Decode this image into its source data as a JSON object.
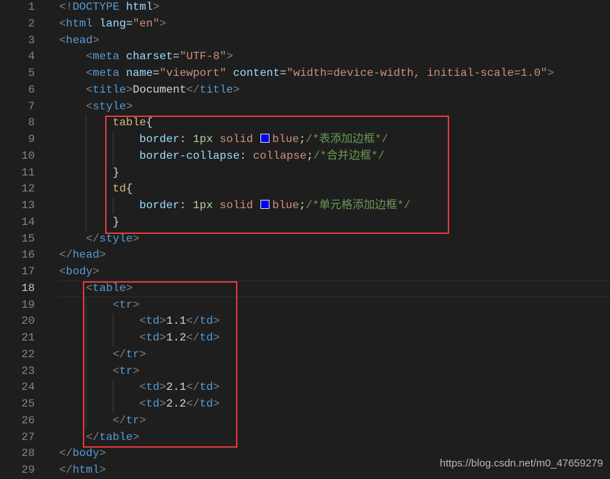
{
  "editor": {
    "active_line": 18,
    "lines": [
      {
        "n": "1",
        "indent": 0,
        "tokens": [
          [
            "p",
            "<!"
          ],
          [
            "t",
            "DOCTYPE"
          ],
          [
            "x",
            " "
          ],
          [
            "a",
            "html"
          ],
          [
            "p",
            ">"
          ]
        ]
      },
      {
        "n": "2",
        "indent": 0,
        "tokens": [
          [
            "p",
            "<"
          ],
          [
            "t",
            "html"
          ],
          [
            "x",
            " "
          ],
          [
            "a",
            "lang"
          ],
          [
            "x",
            "="
          ],
          [
            "s",
            "\"en\""
          ],
          [
            "p",
            ">"
          ]
        ]
      },
      {
        "n": "3",
        "indent": 0,
        "tokens": [
          [
            "p",
            "<"
          ],
          [
            "t",
            "head"
          ],
          [
            "p",
            ">"
          ]
        ]
      },
      {
        "n": "4",
        "indent": 1,
        "tokens": [
          [
            "p",
            "<"
          ],
          [
            "t",
            "meta"
          ],
          [
            "x",
            " "
          ],
          [
            "a",
            "charset"
          ],
          [
            "x",
            "="
          ],
          [
            "s",
            "\"UTF-8\""
          ],
          [
            "p",
            ">"
          ]
        ]
      },
      {
        "n": "5",
        "indent": 1,
        "tokens": [
          [
            "p",
            "<"
          ],
          [
            "t",
            "meta"
          ],
          [
            "x",
            " "
          ],
          [
            "a",
            "name"
          ],
          [
            "x",
            "="
          ],
          [
            "s",
            "\"viewport\""
          ],
          [
            "x",
            " "
          ],
          [
            "a",
            "content"
          ],
          [
            "x",
            "="
          ],
          [
            "s",
            "\"width=device-width, initial-scale=1.0\""
          ],
          [
            "p",
            ">"
          ]
        ]
      },
      {
        "n": "6",
        "indent": 1,
        "tokens": [
          [
            "p",
            "<"
          ],
          [
            "t",
            "title"
          ],
          [
            "p",
            ">"
          ],
          [
            "x",
            "Document"
          ],
          [
            "p",
            "</"
          ],
          [
            "t",
            "title"
          ],
          [
            "p",
            ">"
          ]
        ]
      },
      {
        "n": "7",
        "indent": 1,
        "tokens": [
          [
            "p",
            "<"
          ],
          [
            "t",
            "style"
          ],
          [
            "p",
            ">"
          ]
        ]
      },
      {
        "n": "8",
        "indent": 2,
        "tokens": [
          [
            "sel",
            "table"
          ],
          [
            "x",
            "{"
          ]
        ]
      },
      {
        "n": "9",
        "indent": 3,
        "tokens": [
          [
            "pr",
            "border"
          ],
          [
            "x",
            ": "
          ],
          [
            "n",
            "1px"
          ],
          [
            "x",
            " "
          ],
          [
            "v",
            "solid "
          ],
          [
            "sw",
            ""
          ],
          [
            "v",
            "blue"
          ],
          [
            "x",
            ";"
          ],
          [
            "c",
            "/*表添加边框*/"
          ]
        ]
      },
      {
        "n": "10",
        "indent": 3,
        "tokens": [
          [
            "pr",
            "border-collapse"
          ],
          [
            "x",
            ": "
          ],
          [
            "v",
            "collapse"
          ],
          [
            "x",
            ";"
          ],
          [
            "c",
            "/*合并边框*/"
          ]
        ]
      },
      {
        "n": "11",
        "indent": 2,
        "tokens": [
          [
            "x",
            "}"
          ]
        ]
      },
      {
        "n": "12",
        "indent": 2,
        "tokens": [
          [
            "sel",
            "td"
          ],
          [
            "x",
            "{"
          ]
        ]
      },
      {
        "n": "13",
        "indent": 3,
        "tokens": [
          [
            "pr",
            "border"
          ],
          [
            "x",
            ": "
          ],
          [
            "n",
            "1px"
          ],
          [
            "x",
            " "
          ],
          [
            "v",
            "solid "
          ],
          [
            "sw",
            ""
          ],
          [
            "v",
            "blue"
          ],
          [
            "x",
            ";"
          ],
          [
            "c",
            "/*单元格添加边框*/"
          ]
        ]
      },
      {
        "n": "14",
        "indent": 2,
        "tokens": [
          [
            "x",
            "}"
          ]
        ]
      },
      {
        "n": "15",
        "indent": 1,
        "tokens": [
          [
            "p",
            "</"
          ],
          [
            "t",
            "style"
          ],
          [
            "p",
            ">"
          ]
        ]
      },
      {
        "n": "16",
        "indent": 0,
        "tokens": [
          [
            "p",
            "</"
          ],
          [
            "t",
            "head"
          ],
          [
            "p",
            ">"
          ]
        ]
      },
      {
        "n": "17",
        "indent": 0,
        "tokens": [
          [
            "p",
            "<"
          ],
          [
            "t",
            "body"
          ],
          [
            "p",
            ">"
          ]
        ]
      },
      {
        "n": "18",
        "indent": 1,
        "tokens": [
          [
            "p",
            "<"
          ],
          [
            "t",
            "table"
          ],
          [
            "p",
            ">"
          ]
        ]
      },
      {
        "n": "19",
        "indent": 2,
        "tokens": [
          [
            "p",
            "<"
          ],
          [
            "t",
            "tr"
          ],
          [
            "p",
            ">"
          ]
        ]
      },
      {
        "n": "20",
        "indent": 3,
        "tokens": [
          [
            "p",
            "<"
          ],
          [
            "t",
            "td"
          ],
          [
            "p",
            ">"
          ],
          [
            "x",
            "1.1"
          ],
          [
            "p",
            "</"
          ],
          [
            "t",
            "td"
          ],
          [
            "p",
            ">"
          ]
        ]
      },
      {
        "n": "21",
        "indent": 3,
        "tokens": [
          [
            "p",
            "<"
          ],
          [
            "t",
            "td"
          ],
          [
            "p",
            ">"
          ],
          [
            "x",
            "1.2"
          ],
          [
            "p",
            "</"
          ],
          [
            "t",
            "td"
          ],
          [
            "p",
            ">"
          ]
        ]
      },
      {
        "n": "22",
        "indent": 2,
        "tokens": [
          [
            "p",
            "</"
          ],
          [
            "t",
            "tr"
          ],
          [
            "p",
            ">"
          ]
        ]
      },
      {
        "n": "23",
        "indent": 2,
        "tokens": [
          [
            "p",
            "<"
          ],
          [
            "t",
            "tr"
          ],
          [
            "p",
            ">"
          ]
        ]
      },
      {
        "n": "24",
        "indent": 3,
        "tokens": [
          [
            "p",
            "<"
          ],
          [
            "t",
            "td"
          ],
          [
            "p",
            ">"
          ],
          [
            "x",
            "2.1"
          ],
          [
            "p",
            "</"
          ],
          [
            "t",
            "td"
          ],
          [
            "p",
            ">"
          ]
        ]
      },
      {
        "n": "25",
        "indent": 3,
        "tokens": [
          [
            "p",
            "<"
          ],
          [
            "t",
            "td"
          ],
          [
            "p",
            ">"
          ],
          [
            "x",
            "2.2"
          ],
          [
            "p",
            "</"
          ],
          [
            "t",
            "td"
          ],
          [
            "p",
            ">"
          ]
        ]
      },
      {
        "n": "26",
        "indent": 2,
        "tokens": [
          [
            "p",
            "</"
          ],
          [
            "t",
            "tr"
          ],
          [
            "p",
            ">"
          ]
        ]
      },
      {
        "n": "27",
        "indent": 1,
        "tokens": [
          [
            "p",
            "</"
          ],
          [
            "t",
            "table"
          ],
          [
            "p",
            ">"
          ]
        ]
      },
      {
        "n": "28",
        "indent": 0,
        "tokens": [
          [
            "p",
            "</"
          ],
          [
            "t",
            "body"
          ],
          [
            "p",
            ">"
          ]
        ]
      },
      {
        "n": "29",
        "indent": 0,
        "tokens": [
          [
            "p",
            "</"
          ],
          [
            "t",
            "html"
          ],
          [
            "p",
            ">"
          ]
        ]
      }
    ]
  },
  "colors": {
    "swatch": "#0000ff",
    "highlight_box": "#e8393a",
    "background": "#1e1e1e"
  },
  "watermark": "https://blog.csdn.net/m0_47659279"
}
